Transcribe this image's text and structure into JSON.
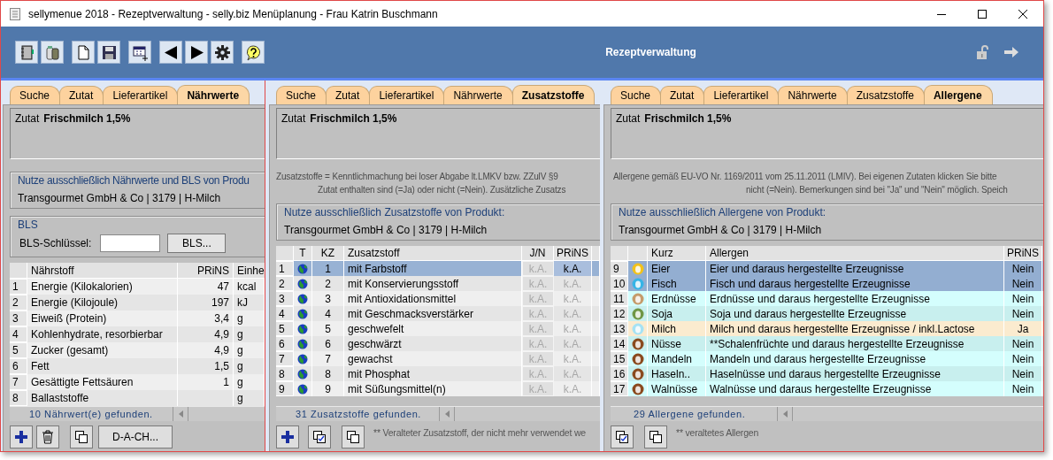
{
  "window": {
    "title": "sellymenue 2018 - Rezeptverwaltung - selly.biz Menüplanung - Frau Katrin Buschmann"
  },
  "toolbar": {
    "title": "Rezeptverwaltung"
  },
  "panels": [
    {
      "kind": "naehrwerte",
      "tabs": [
        {
          "label": "Suche",
          "selected": false
        },
        {
          "label": "Zutat",
          "selected": false
        },
        {
          "label": "Lieferartikel",
          "selected": false
        },
        {
          "label": "Nährwerte",
          "selected": true
        }
      ],
      "ingredient": {
        "label": "Zutat",
        "value": "Frischmilch 1,5%"
      },
      "product_group": {
        "legend": "Nutze ausschließlich Nährwerte und BLS von Produ",
        "value": "Transgourmet GmbH & Co | 3179 | H-Milch"
      },
      "bls": {
        "legend": "BLS",
        "label": "BLS-Schlüssel:",
        "button": "BLS..."
      },
      "table": {
        "columns": [
          "Nährstoff",
          "PRiNS",
          "Einhe"
        ],
        "rows": [
          {
            "num": "1",
            "name": "Energie (Kilokalorien)",
            "value": "47",
            "unit": "kcal"
          },
          {
            "num": "2",
            "name": "Energie (Kilojoule)",
            "value": "197",
            "unit": "kJ"
          },
          {
            "num": "3",
            "name": "Eiweiß (Protein)",
            "value": "3,4",
            "unit": "g"
          },
          {
            "num": "4",
            "name": "Kohlenhydrate, resorbierbar",
            "value": "4,9",
            "unit": "g"
          },
          {
            "num": "5",
            "name": "Zucker (gesamt)",
            "value": "4,9",
            "unit": "g"
          },
          {
            "num": "6",
            "name": "Fett",
            "value": "1,5",
            "unit": "g"
          },
          {
            "num": "7",
            "name": "Gesättigte Fettsäuren",
            "value": "1",
            "unit": "g"
          },
          {
            "num": "8",
            "name": "Ballaststoffe",
            "unit": "g"
          }
        ]
      },
      "status": "10  Nährwert(e) gefunden.",
      "footer": {
        "buttons": [
          {
            "kind": "add"
          },
          {
            "kind": "delete"
          },
          {
            "kind": "copy"
          },
          {
            "kind": "text",
            "label": "D-A-CH..."
          }
        ]
      }
    },
    {
      "kind": "zusatzstoffe",
      "tabs": [
        {
          "label": "Suche",
          "selected": false
        },
        {
          "label": "Zutat",
          "selected": false
        },
        {
          "label": "Lieferartikel",
          "selected": false
        },
        {
          "label": "Nährwerte",
          "selected": false
        },
        {
          "label": "Zusatzstoffe",
          "selected": true
        }
      ],
      "ingredient": {
        "label": "Zutat",
        "value": "Frischmilch 1,5%"
      },
      "info_lines": [
        "Zusatzstoffe = Kenntlichmachung bei loser Abgabe lt.LMKV bzw. ZZulV §9",
        "Zutat enthalten sind (=Ja) oder nicht (=Nein). Zusätzliche Zusatzs"
      ],
      "product_group": {
        "legend": "Nutze ausschließlich Zusatzstoffe von Produkt:",
        "value": "Transgourmet GmbH & Co | 3179 | H-Milch"
      },
      "table": {
        "columns": [
          "T",
          "KZ",
          "Zusatzstoff",
          "J/N",
          "PRiNS"
        ],
        "rows": [
          {
            "num": "1",
            "kz": "1",
            "name": "mit Farbstoff",
            "jn": "k.A.",
            "prins": "k.A.",
            "selected": true
          },
          {
            "num": "2",
            "kz": "2",
            "name": "mit Konservierungsstoff",
            "jn": "k.A.",
            "prins": "k.A.",
            "selected": false
          },
          {
            "num": "3",
            "kz": "3",
            "name": "mit Antioxidationsmittel",
            "jn": "k.A.",
            "prins": "k.A.",
            "selected": false
          },
          {
            "num": "4",
            "kz": "4",
            "name": "mit Geschmacksverstärker",
            "jn": "k.A.",
            "prins": "k.A.",
            "selected": false
          },
          {
            "num": "5",
            "kz": "5",
            "name": "geschwefelt",
            "jn": "k.A.",
            "prins": "k.A.",
            "selected": false
          },
          {
            "num": "6",
            "kz": "6",
            "name": "geschwärzt",
            "jn": "k.A.",
            "prins": "k.A.",
            "selected": false
          },
          {
            "num": "7",
            "kz": "7",
            "name": "gewachst",
            "jn": "k.A.",
            "prins": "k.A.",
            "selected": false
          },
          {
            "num": "8",
            "kz": "8",
            "name": "mit Phosphat",
            "jn": "k.A.",
            "prins": "k.A.",
            "selected": false
          },
          {
            "num": "9",
            "kz": "9",
            "name": "mit Süßungsmittel(n)",
            "jn": "k.A.",
            "prins": "k.A.",
            "selected": false
          }
        ]
      },
      "status": "31  Zusatzstoffe gefunden.",
      "footer": {
        "buttons": [
          {
            "kind": "add"
          },
          {
            "kind": "check-copy"
          },
          {
            "kind": "copy"
          }
        ],
        "note": "** Veralteter Zusatzstoff, der nicht mehr verwendet we"
      }
    },
    {
      "kind": "allergene",
      "tabs": [
        {
          "label": "Suche",
          "selected": false
        },
        {
          "label": "Zutat",
          "selected": false
        },
        {
          "label": "Lieferartikel",
          "selected": false
        },
        {
          "label": "Nährwerte",
          "selected": false
        },
        {
          "label": "Zusatzstoffe",
          "selected": false
        },
        {
          "label": "Allergene",
          "selected": true
        }
      ],
      "ingredient": {
        "label": "Zutat",
        "value": "Frischmilch 1,5%"
      },
      "info_lines": [
        "Allergene gemäß EU-VO Nr. 1169/2011 vom 25.11.2011 (LMIV). Bei eigenen Zutaten klicken Sie bitte",
        "nicht (=Nein). Bemerkungen sind bei \"Ja\" und \"Nein\" möglich. Speich"
      ],
      "product_group": {
        "legend": "Nutze ausschließlich Allergene von Produkt:",
        "value": "Transgourmet GmbH & Co | 3179 | H-Milch"
      },
      "table": {
        "columns": [
          "Kurz",
          "Allergen",
          "PRiNS"
        ],
        "rows": [
          {
            "num": "9",
            "kurz": "Eier",
            "name": "Eier und daraus hergestellte Erzeugnisse",
            "prins": "Nein",
            "selected": true,
            "contains": false,
            "color": "#f2c21a"
          },
          {
            "num": "10",
            "kurz": "Fisch",
            "name": "Fisch und daraus hergestellte Erzeugnisse",
            "prins": "Nein",
            "selected": true,
            "contains": false,
            "color": "#36b4e6"
          },
          {
            "num": "11",
            "kurz": "Erdnüsse",
            "name": "Erdnüsse und daraus hergestellte Erzeugnisse",
            "prins": "Nein",
            "selected": false,
            "contains": false,
            "color": "#c59c6c"
          },
          {
            "num": "12",
            "kurz": "Soja",
            "name": "Soja und daraus hergestellte Erzeugnisse",
            "prins": "Nein",
            "selected": false,
            "contains": false,
            "color": "#6f9646"
          },
          {
            "num": "13",
            "kurz": "Milch",
            "name": "Milch und daraus hergestellte Erzeugnisse / inkl.Lactose",
            "prins": "Ja",
            "selected": false,
            "contains": true,
            "color": "#a6e2f4"
          },
          {
            "num": "14",
            "kurz": "Nüsse",
            "name": "**Schalenfrüchte und daraus hergestellte Erzeugnisse",
            "prins": "Nein",
            "selected": false,
            "contains": false,
            "color": "#8a4a1e"
          },
          {
            "num": "15",
            "kurz": "Mandeln",
            "name": "Mandeln und daraus hergestellte Erzeugnisse",
            "prins": "Nein",
            "selected": false,
            "contains": false,
            "color": "#8a4a1e"
          },
          {
            "num": "16",
            "kurz": "Haseln..",
            "name": "Haselnüsse und daraus hergestellte Erzeugnisse",
            "prins": "Nein",
            "selected": false,
            "contains": false,
            "color": "#8a4a1e"
          },
          {
            "num": "17",
            "kurz": "Walnüsse",
            "name": "Walnüsse und daraus hergestellte Erzeugnisse",
            "prins": "Nein",
            "selected": false,
            "contains": false,
            "color": "#8a4a1e"
          }
        ]
      },
      "status": "29  Allergene gefunden.",
      "footer": {
        "buttons": [
          {
            "kind": "check-copy"
          },
          {
            "kind": "copy"
          }
        ],
        "note": "** veraltetes Allergen"
      }
    }
  ]
}
